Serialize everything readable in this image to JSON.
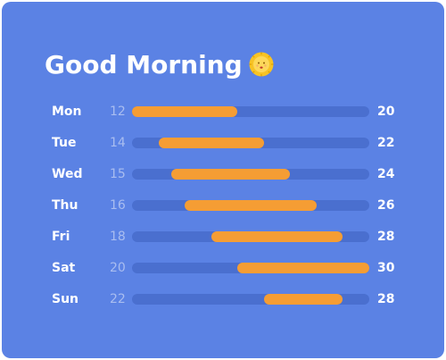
{
  "card": {
    "background_color": "#5b82e4",
    "track_color": "#4a6fcf",
    "bar_color": "#f59d34"
  },
  "greeting": {
    "text": "Good Morning",
    "icon": "sun-face-icon"
  },
  "scale": {
    "min": 12,
    "max": 30
  },
  "forecast": [
    {
      "day": "Mon",
      "low": 12,
      "high": 20
    },
    {
      "day": "Tue",
      "low": 14,
      "high": 22
    },
    {
      "day": "Wed",
      "low": 15,
      "high": 24
    },
    {
      "day": "Thu",
      "low": 16,
      "high": 26
    },
    {
      "day": "Fri",
      "low": 18,
      "high": 28
    },
    {
      "day": "Sat",
      "low": 20,
      "high": 30
    },
    {
      "day": "Sun",
      "low": 22,
      "high": 28
    }
  ]
}
